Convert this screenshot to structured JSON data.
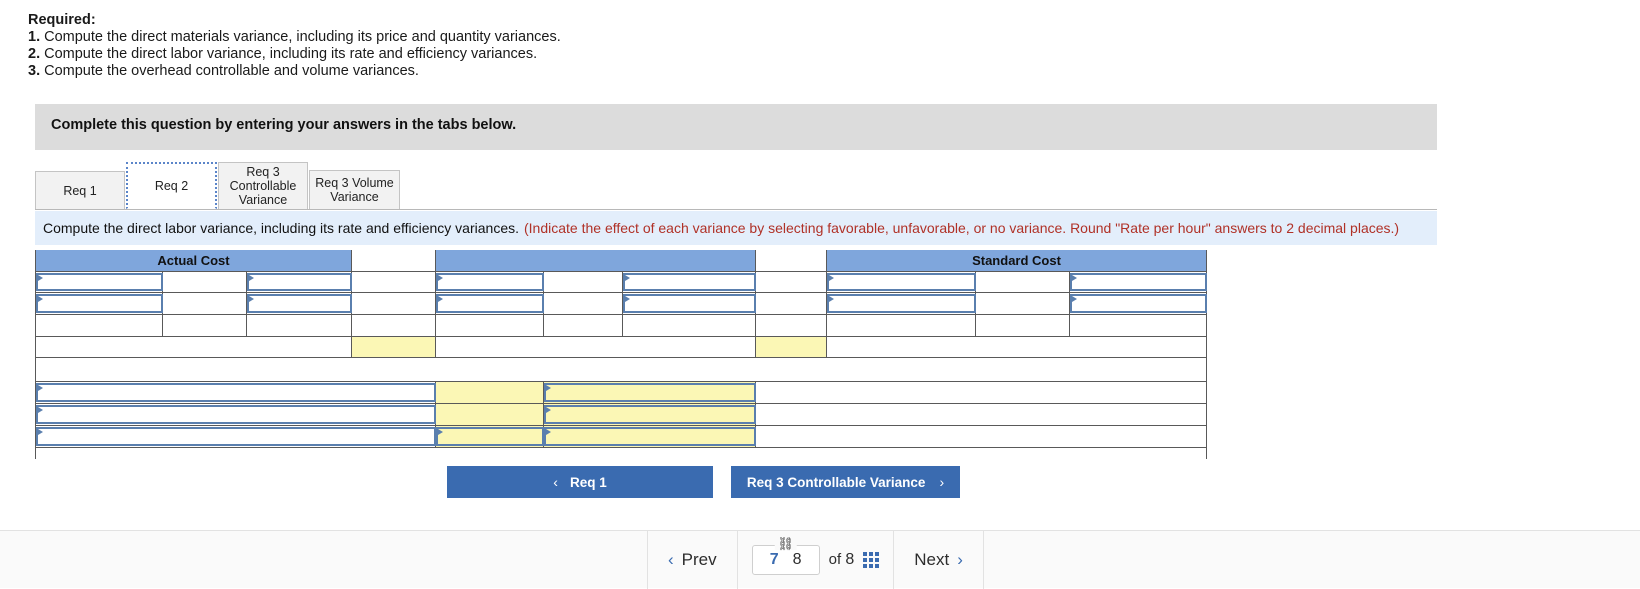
{
  "required": {
    "title": "Required:",
    "items": [
      {
        "num": "1.",
        "text": "Compute the direct materials variance, including its price and quantity variances."
      },
      {
        "num": "2.",
        "text": "Compute the direct labor variance, including its rate and efficiency variances."
      },
      {
        "num": "3.",
        "text": "Compute the overhead controllable and volume variances."
      }
    ]
  },
  "banner": {
    "text": "Complete this question by entering your answers in the tabs below."
  },
  "tabs": [
    {
      "label": "Req 1",
      "active": false
    },
    {
      "label": "Req 2",
      "active": true
    },
    {
      "label": "Req 3 Controllable Variance",
      "active": false
    },
    {
      "label": "Req 3 Volume Variance",
      "active": false
    }
  ],
  "prompt": {
    "main": "Compute the direct labor variance, including its rate and efficiency variances.",
    "hint": "(Indicate the effect of each variance by selecting favorable, unfavorable, or no variance. Round \"Rate per hour\" answers to 2 decimal places.)"
  },
  "worksheet": {
    "headers": {
      "actual_cost": "Actual Cost",
      "middle": "",
      "standard_cost": "Standard Cost"
    },
    "rows": [
      {
        "type": "header"
      },
      {
        "type": "inputs"
      },
      {
        "type": "inputs"
      },
      {
        "type": "empty"
      },
      {
        "type": "yellow-accent"
      },
      {
        "type": "spacer"
      },
      {
        "type": "variance-a"
      },
      {
        "type": "variance-b"
      },
      {
        "type": "variance-c"
      }
    ],
    "cell_values": []
  },
  "req_nav": {
    "prev_label": "Req 1",
    "prev_chevron": "‹",
    "next_label": "Req 3 Controllable Variance",
    "next_chevron": "›"
  },
  "footer": {
    "prev_label": "Prev",
    "prev_chevron": "‹",
    "next_label": "Next",
    "next_chevron": "›",
    "current_page": "7",
    "linked_page": "8",
    "of_label": "of",
    "total_pages": "8",
    "link_icon": "⛓",
    "grid_icon": "grid-icon"
  },
  "colors": {
    "header_blue": "#7fa6dc",
    "input_border": "#5a7fae",
    "yellow": "#fbf7b5",
    "button_blue": "#3a6bb0",
    "banner_grey": "#dcdcdc",
    "prompt_blue": "#e3eefb",
    "hint_red": "#b03127"
  }
}
